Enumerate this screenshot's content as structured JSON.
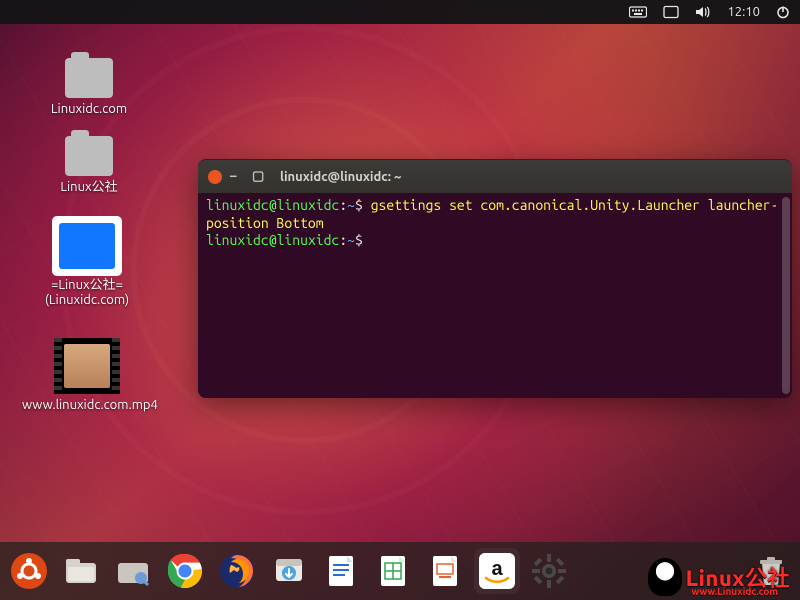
{
  "panel": {
    "time": "12:10"
  },
  "desktop_icons": [
    {
      "label": "Linuxidc.com"
    },
    {
      "label": "Linux公社"
    },
    {
      "label": "=Linux公社=(Linuxidc.com)"
    },
    {
      "label": "www.linuxidc.com.mp4"
    }
  ],
  "terminal": {
    "title": "linuxidc@linuxidc: ~",
    "user": "linuxidc",
    "host": "linuxidc",
    "cwd": "~",
    "command": "gsettings set com.canonical.Unity.Launcher launcher-position Bottom",
    "prompt_sep": ":",
    "prompt_char": "$"
  },
  "dock": [
    "show-apps",
    "files",
    "archive-manager",
    "chrome",
    "firefox",
    "software-updater",
    "libreoffice-writer",
    "libreoffice-calc",
    "libreoffice-impress",
    "amazon",
    "settings",
    "trash"
  ],
  "watermark": {
    "brand": "Linux公社",
    "url": "www.Linuxidc.com"
  }
}
